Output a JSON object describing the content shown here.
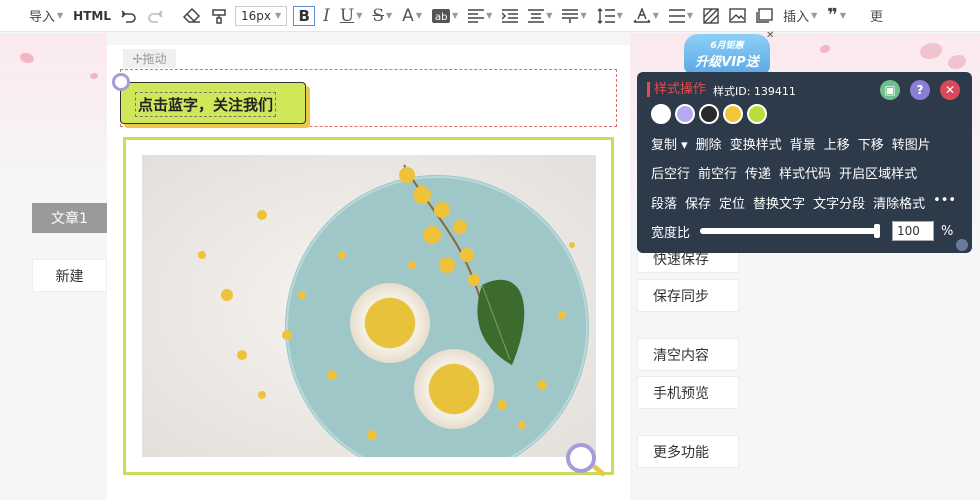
{
  "toolbar": {
    "import_label": "导入",
    "html_label": "HTML",
    "font_size": "16px",
    "insert_label": "插入",
    "edge_text": "更"
  },
  "sidebar": {
    "article_tab": "文章1",
    "new_button": "新建"
  },
  "editor": {
    "drag_label": "✢拖动",
    "banner_text": "点击蓝字，关注我们"
  },
  "vip_banner": {
    "top_text": "6月钜惠",
    "main_text": "升级VIP送"
  },
  "style_panel": {
    "title": "样式操作",
    "style_id": "样式ID: 139411",
    "swatches": [
      "#ffffff",
      "#b7a9f0",
      "#2a2a2a",
      "#f2c83a",
      "#b8dd3c"
    ],
    "row1": [
      "复制 ▾",
      "删除",
      "变换样式",
      "背景",
      "上移",
      "下移",
      "转图片"
    ],
    "row2": [
      "后空行",
      "前空行",
      "传递",
      "样式代码",
      "开启区域样式"
    ],
    "row3": [
      "段落",
      "保存",
      "定位",
      "替换文字",
      "文字分段",
      "清除格式",
      "•••"
    ],
    "width_label": "宽度比",
    "width_value": "100",
    "width_unit": "%",
    "width_fraction": 1.0
  },
  "right_menu": [
    "快速保存",
    "保存同步",
    "清空内容",
    "手机预览",
    "更多功能"
  ],
  "colors": {
    "accent_green": "#c8dd5e",
    "panel_bg": "#2d3a4a",
    "title_red": "#e84a4a"
  }
}
